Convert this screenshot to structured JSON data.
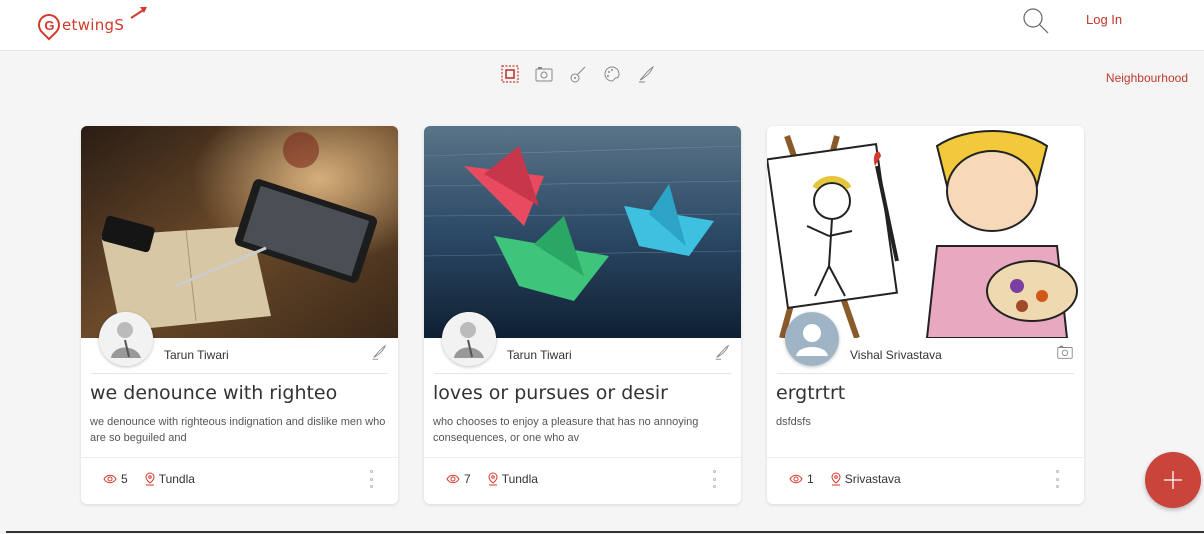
{
  "brand": {
    "name": "etwingS",
    "pin_letter": "G",
    "color": "#d33a2c"
  },
  "header": {
    "login_label": "Log In"
  },
  "categories": [
    "all-icon",
    "camera-icon",
    "guitar-icon",
    "palette-icon",
    "quill-icon"
  ],
  "neighbourhood_label": "Neighbourhood",
  "cards": [
    {
      "author": "Tarun Tiwari",
      "type_icon": "quill-icon",
      "title": "we denounce with righteo",
      "description": "we denounce with righteous indignation and dislike men who are so beguiled and",
      "views": "5",
      "location": "Tundla"
    },
    {
      "author": "Tarun Tiwari",
      "type_icon": "quill-icon",
      "title": "loves or pursues or desir",
      "description": "who chooses to enjoy a pleasure that has no annoying consequences, or one who av",
      "views": "7",
      "location": "Tundla"
    },
    {
      "author": "Vishal Srivastava",
      "type_icon": "camera-icon",
      "title": "ergtrtrt",
      "description": "dsfdsfs",
      "views": "1",
      "location": "Srivastava"
    }
  ],
  "fab_icon": "plus-icon",
  "accent": "#c9443a"
}
